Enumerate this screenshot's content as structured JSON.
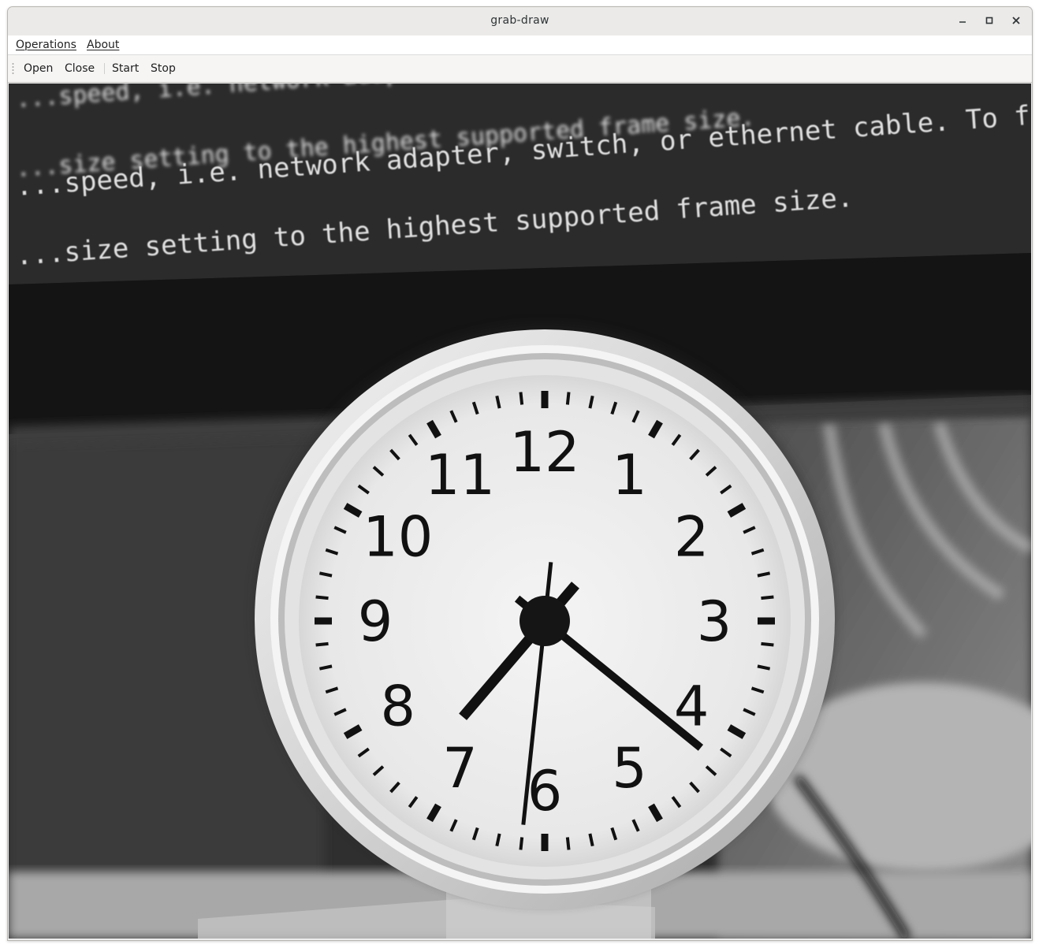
{
  "window": {
    "title": "grab-draw",
    "controls": {
      "minimize": "–",
      "maximize": "□",
      "close": "✕"
    }
  },
  "menubar": {
    "items": [
      {
        "label": "Operations"
      },
      {
        "label": "About"
      }
    ]
  },
  "toolbar": {
    "open": "Open",
    "close": "Close",
    "start": "Start",
    "stop": "Stop"
  },
  "image": {
    "screen_lines": [
      "...speed, i.e. network adapter, switch, or ethernet cable. To fix",
      "...size setting to the highest supported frame size.",
      "...speed, i.e. network adapter, switch, or ethernet cable. To fix this, try",
      "...size setting to the highest supported frame size."
    ],
    "clock_numerals": [
      "12",
      "1",
      "2",
      "3",
      "4",
      "5",
      "6",
      "7",
      "8",
      "9",
      "10",
      "11"
    ],
    "clock_time": {
      "hour": 7,
      "minute": 21,
      "second": 31
    },
    "palette": {
      "background": "#303030",
      "monitor": "#2a2a2a",
      "clock_face": "#efefef",
      "clock_rim": "#dcdcdc",
      "ink": "#111111"
    }
  }
}
